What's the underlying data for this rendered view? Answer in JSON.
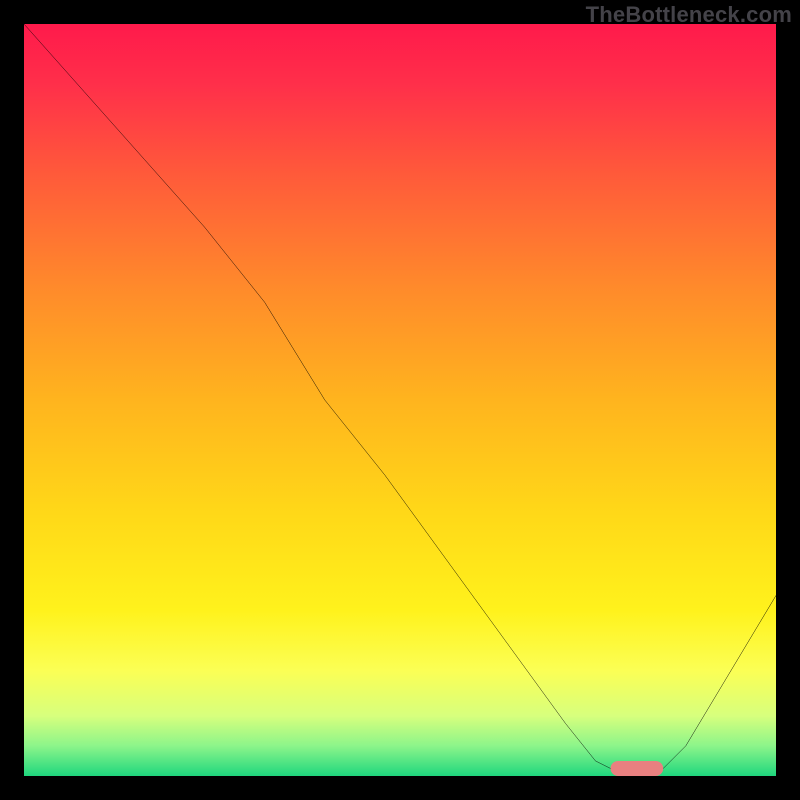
{
  "watermark": "TheBottleneck.com",
  "chart_data": {
    "type": "line",
    "title": "",
    "xlabel": "",
    "ylabel": "",
    "xlim": [
      0,
      100
    ],
    "ylim": [
      0,
      100
    ],
    "grid": false,
    "series": [
      {
        "name": "bottleneck-curve",
        "x": [
          0,
          8,
          16,
          24,
          32,
          40,
          48,
          56,
          64,
          72,
          76,
          80,
          84,
          88,
          100
        ],
        "values": [
          100,
          91,
          82,
          73,
          63,
          50,
          40,
          29,
          18,
          7,
          2,
          0,
          0,
          4,
          24
        ]
      }
    ],
    "marker": {
      "name": "optimal-range",
      "x_start": 78,
      "x_end": 85,
      "y": 1,
      "color": "#e98080"
    },
    "background_gradient": {
      "stops": [
        {
          "offset": 0.0,
          "color": "#ff1a4b"
        },
        {
          "offset": 0.08,
          "color": "#ff2f4a"
        },
        {
          "offset": 0.2,
          "color": "#ff5a3a"
        },
        {
          "offset": 0.35,
          "color": "#ff8a2b"
        },
        {
          "offset": 0.5,
          "color": "#ffb41e"
        },
        {
          "offset": 0.65,
          "color": "#ffd818"
        },
        {
          "offset": 0.78,
          "color": "#fff21c"
        },
        {
          "offset": 0.86,
          "color": "#fbff55"
        },
        {
          "offset": 0.92,
          "color": "#d7ff7d"
        },
        {
          "offset": 0.96,
          "color": "#8cf58a"
        },
        {
          "offset": 1.0,
          "color": "#1fd67e"
        }
      ]
    }
  }
}
